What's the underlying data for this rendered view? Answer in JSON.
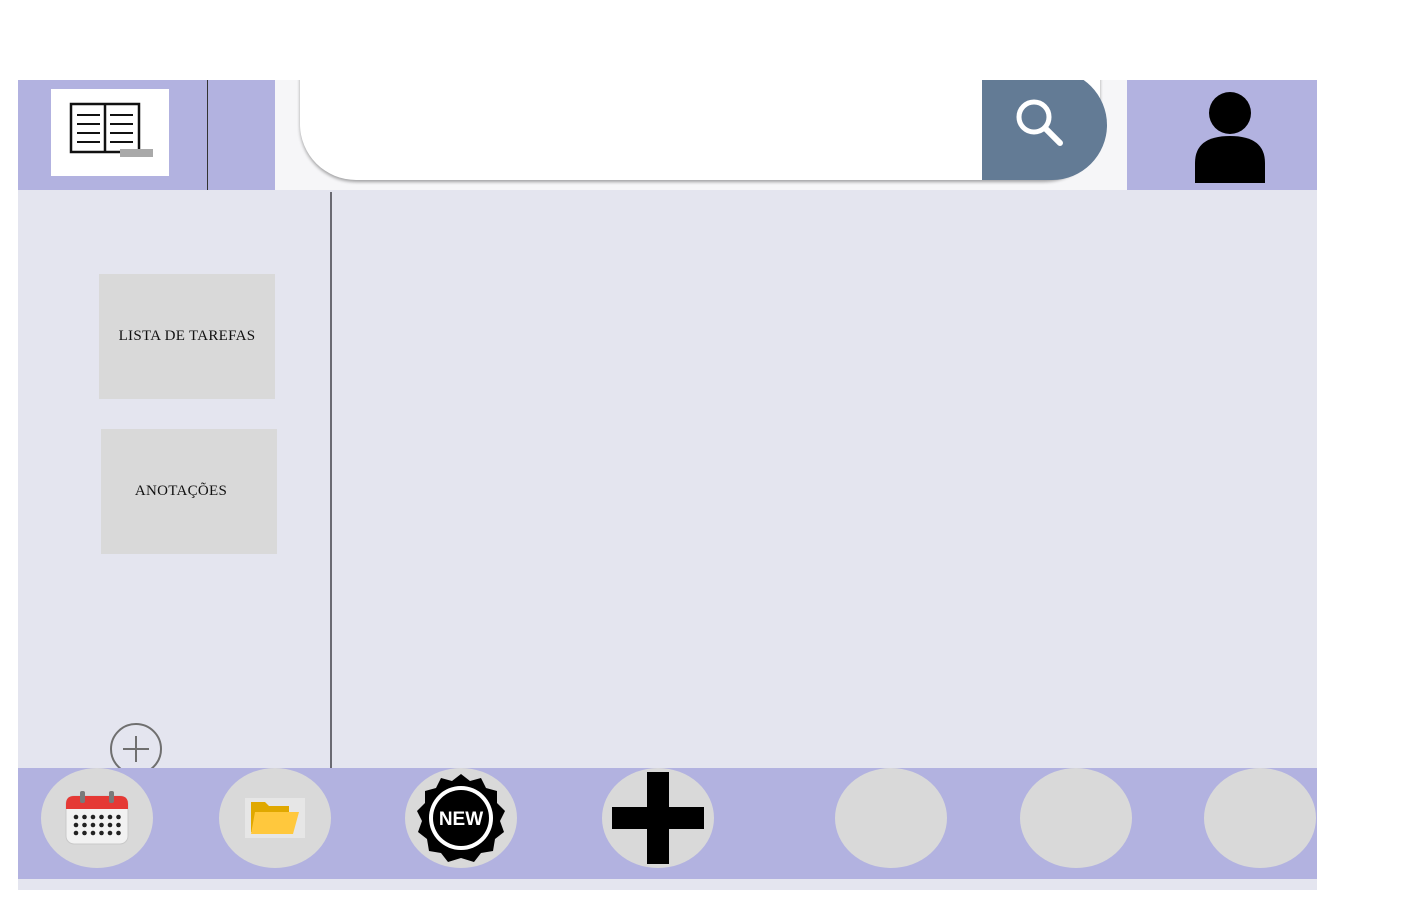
{
  "header": {
    "logo": {
      "icon": "open-book-icon"
    },
    "search": {
      "value": "",
      "placeholder": "",
      "icon": "search-icon",
      "button_color": "#637b95"
    },
    "profile": {
      "icon": "user-icon"
    }
  },
  "sidebar": {
    "items": [
      {
        "label": "LISTA DE TAREFAS"
      },
      {
        "label": "ANOTAÇÕES"
      }
    ],
    "add_icon": "plus-circle-icon"
  },
  "dock": {
    "items": [
      {
        "icon": "calendar-icon"
      },
      {
        "icon": "folder-icon"
      },
      {
        "icon": "new-badge-icon",
        "label": "NEW"
      },
      {
        "icon": "plus-icon"
      },
      {
        "icon": ""
      },
      {
        "icon": ""
      },
      {
        "icon": ""
      }
    ]
  },
  "colors": {
    "bar": "#b2b2e0",
    "background": "#e4e5ef",
    "item": "#d9d9d9",
    "search_button": "#637b95"
  }
}
